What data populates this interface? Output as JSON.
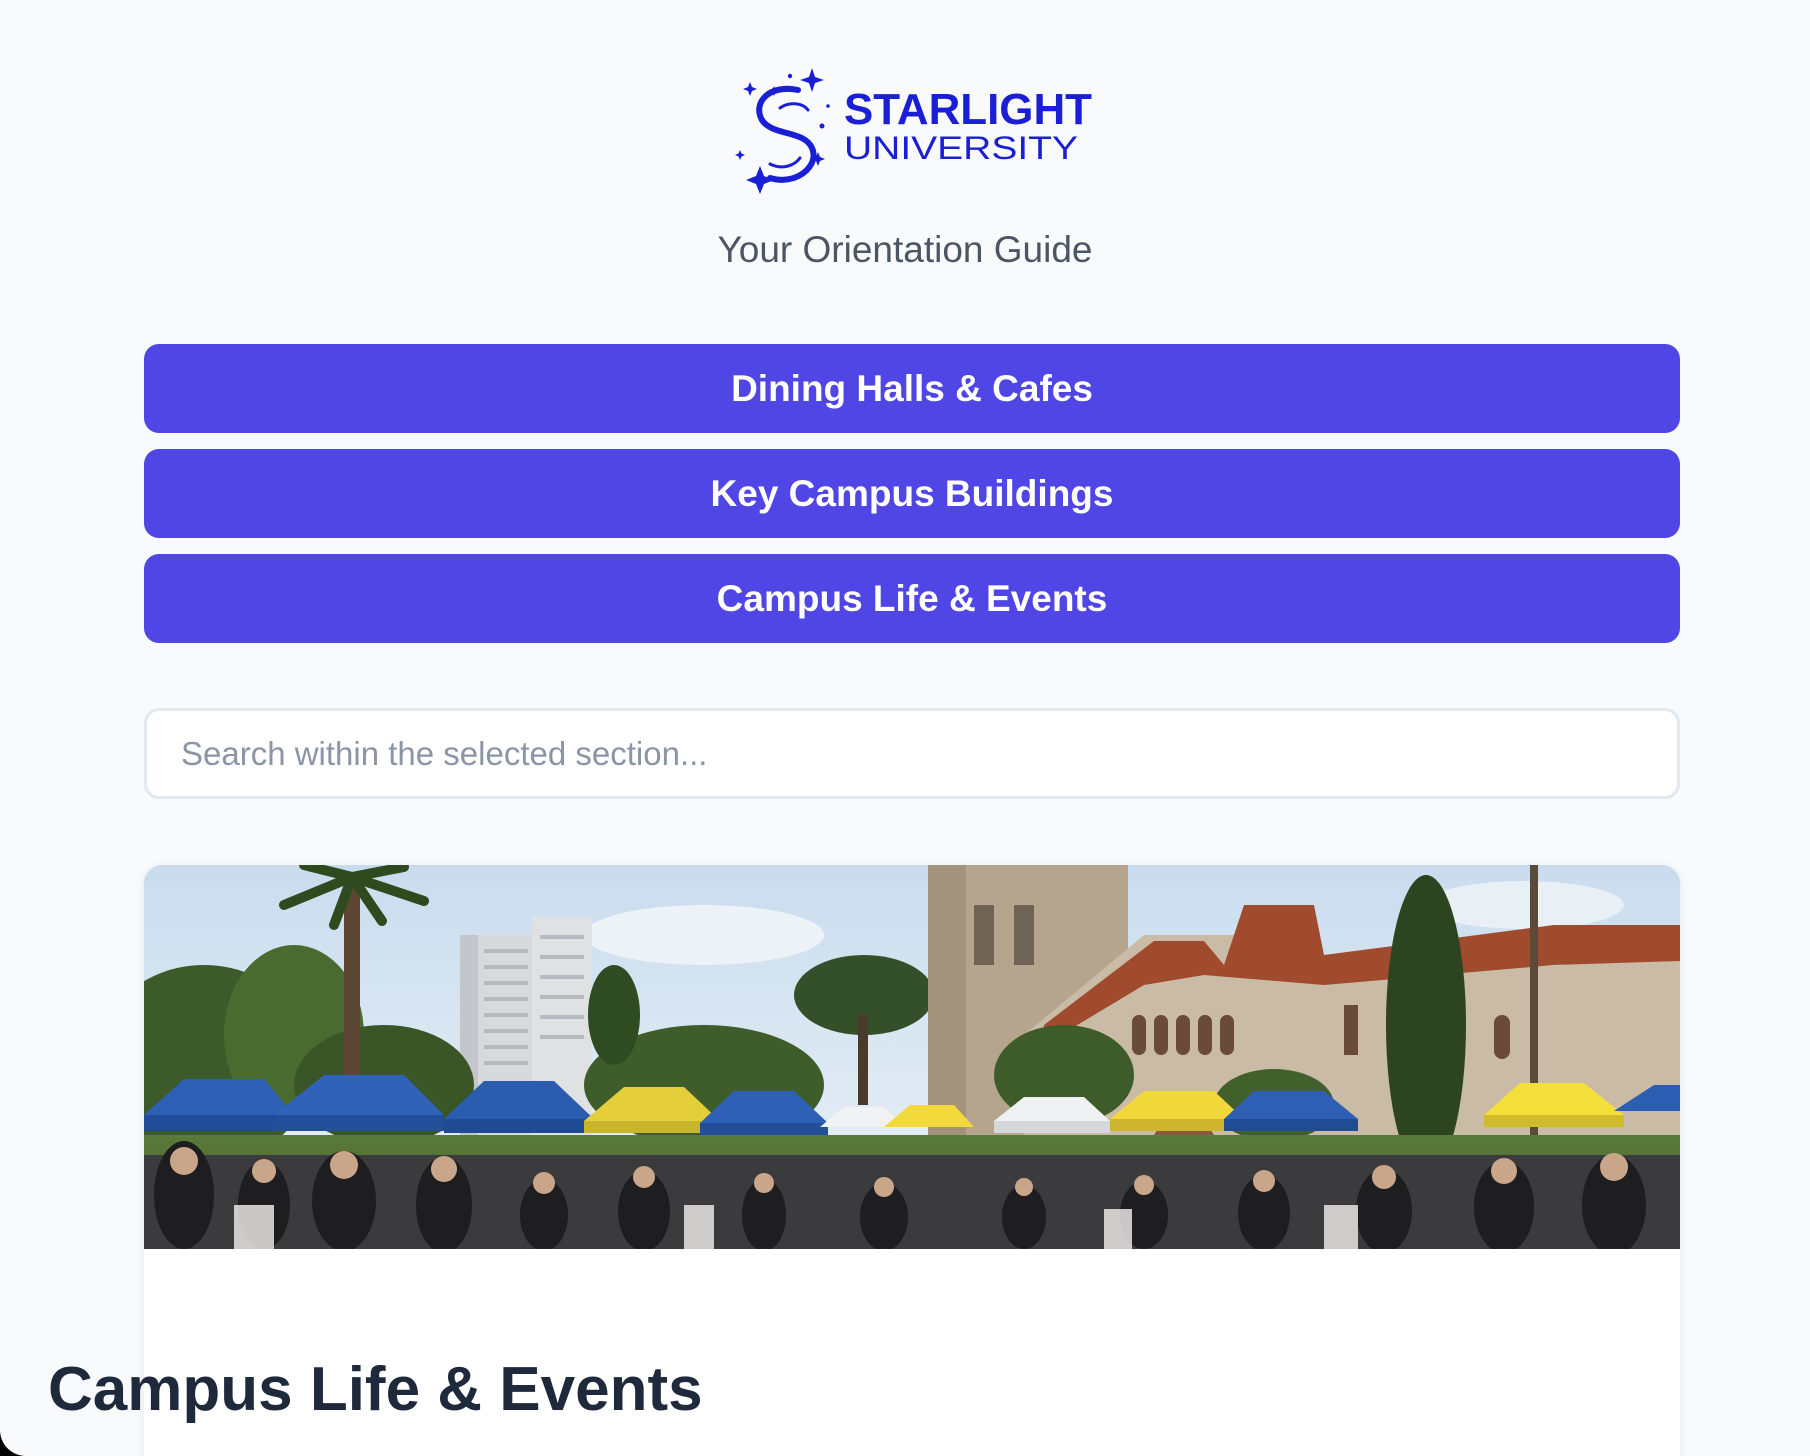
{
  "brand": {
    "name_line1": "STARLIGHT",
    "name_line2": "UNIVERSITY",
    "logo_icon": "star-swirl-s-icon",
    "color": "#1a1fd6"
  },
  "header": {
    "subtitle": "Your Orientation Guide"
  },
  "nav": {
    "buttons": [
      {
        "label": "Dining Halls & Cafes"
      },
      {
        "label": "Key Campus Buildings"
      },
      {
        "label": "Campus Life & Events"
      }
    ],
    "button_color": "#4f46e5"
  },
  "search": {
    "placeholder": "Search within the selected section..."
  },
  "section": {
    "title": "Campus Life & Events",
    "image_alt": "Campus fair with tents and crowd of students"
  },
  "theme": {
    "background": "#f8fafc",
    "text_muted": "#4b5563",
    "title_color": "#1e293b"
  }
}
